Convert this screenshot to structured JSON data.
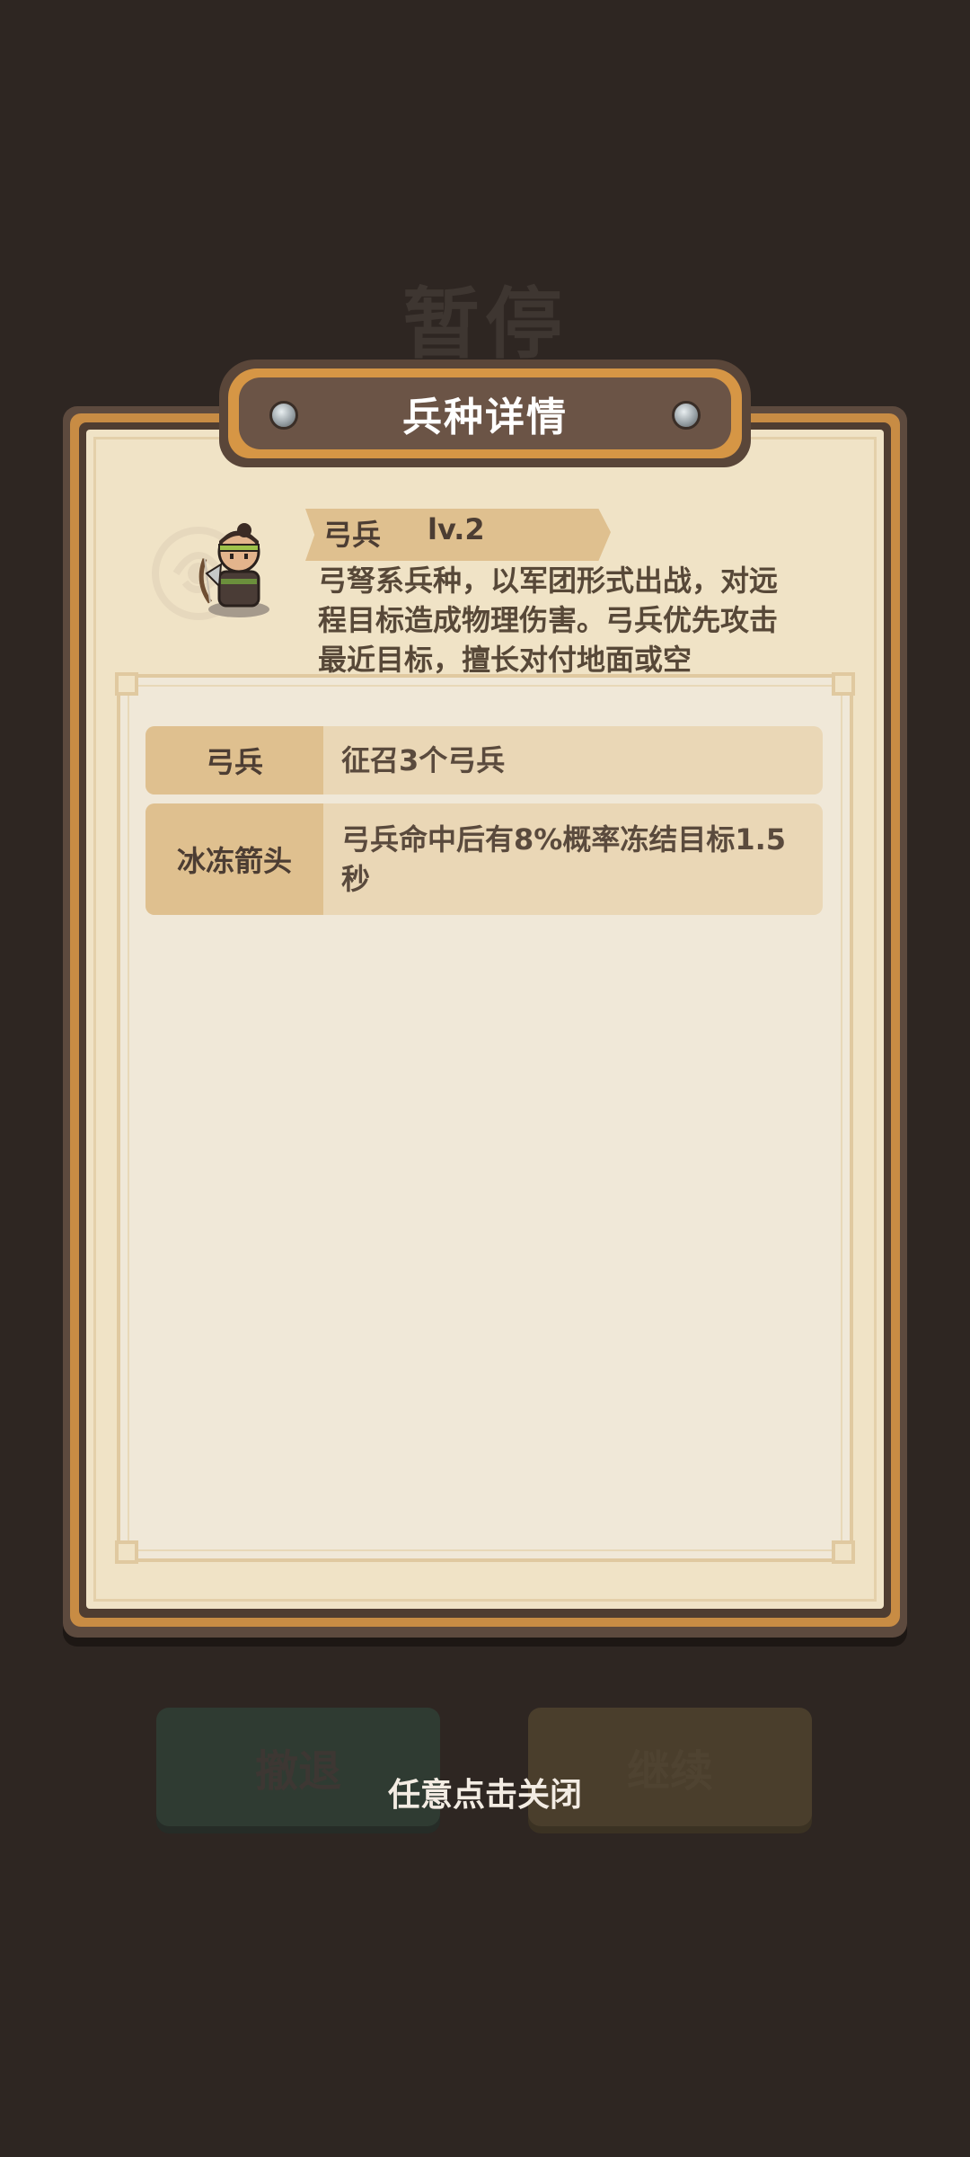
{
  "background": {
    "title": "暂停",
    "retreat_label": "撤退",
    "continue_label": "继续"
  },
  "panel": {
    "title": "兵种详情"
  },
  "unit": {
    "name": "弓兵",
    "level": "lv.2",
    "description": "弓弩系兵种，以军团形式出战，对远程目标造成物理伤害。弓兵优先攻击最近目标，擅长对付地面或空"
  },
  "skills": [
    {
      "label": "弓兵",
      "text": "征召3个弓兵"
    },
    {
      "label": "冰冻箭头",
      "text": "弓兵命中后有8%概率冻结目标1.5秒"
    }
  ],
  "close_hint": "任意点击关闭",
  "colors": {
    "background": "#2e2622",
    "parchment": "#f0e3c6",
    "frame_gold": "#c88c44",
    "label_tan": "#dfc08f"
  }
}
